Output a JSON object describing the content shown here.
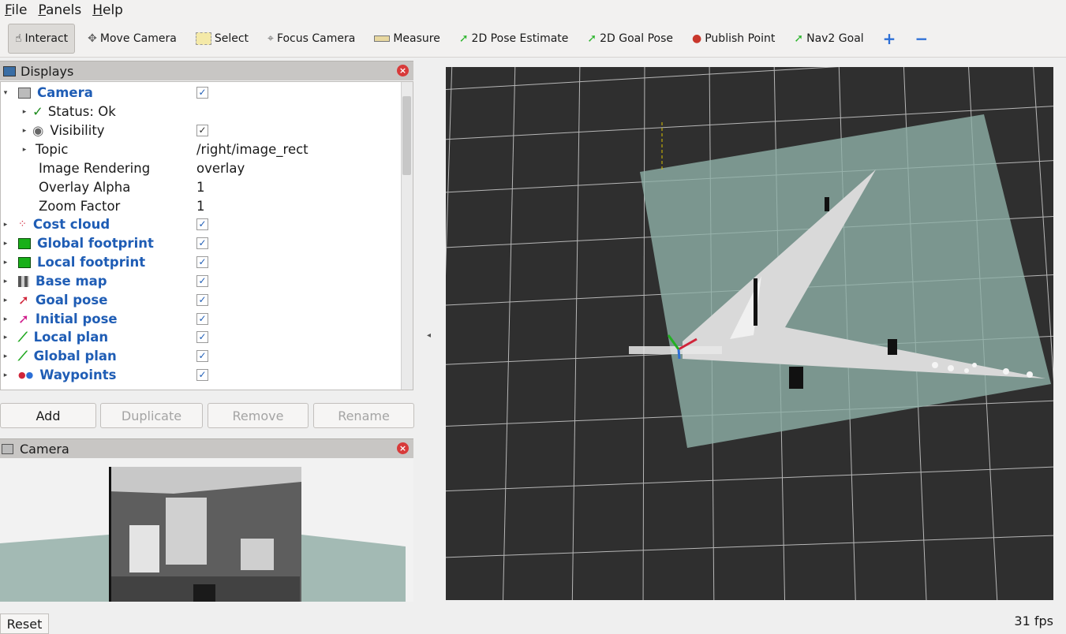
{
  "menu": [
    "File",
    "Panels",
    "Help"
  ],
  "toolbar": [
    {
      "label": "Interact",
      "icon": "hand-pointer-icon",
      "glyph": "☝"
    },
    {
      "label": "Move Camera",
      "icon": "move-camera-icon",
      "glyph": "✥"
    },
    {
      "label": "Select",
      "icon": "select-icon",
      "glyph": "▭"
    },
    {
      "label": "Focus Camera",
      "icon": "focus-camera-icon",
      "glyph": "⌖"
    },
    {
      "label": "Measure",
      "icon": "ruler-icon",
      "glyph": "▬"
    },
    {
      "label": "2D Pose Estimate",
      "icon": "green-arrow-icon",
      "glyph": "➚"
    },
    {
      "label": "2D Goal Pose",
      "icon": "green-arrow-icon",
      "glyph": "➚"
    },
    {
      "label": "Publish Point",
      "icon": "map-pin-icon",
      "glyph": "📍"
    },
    {
      "label": "Nav2 Goal",
      "icon": "green-arrow-icon",
      "glyph": "➚"
    }
  ],
  "displays": {
    "title": "Displays",
    "rows": [
      {
        "label": "Camera",
        "value": "✓",
        "kind": "display",
        "icon": "camera-icon"
      },
      {
        "label": "Status: Ok",
        "value": "",
        "kind": "status"
      },
      {
        "label": "Visibility",
        "value": "✓",
        "kind": "child-arrow"
      },
      {
        "label": "Topic",
        "value": "/right/image_rect",
        "kind": "child-arrow"
      },
      {
        "label": "Image Rendering",
        "value": "overlay",
        "kind": "child"
      },
      {
        "label": "Overlay Alpha",
        "value": "1",
        "kind": "child"
      },
      {
        "label": "Zoom Factor",
        "value": "1",
        "kind": "child"
      },
      {
        "label": "Cost cloud",
        "value": "✓",
        "kind": "display"
      },
      {
        "label": "Global footprint",
        "value": "✓",
        "kind": "display"
      },
      {
        "label": "Local footprint",
        "value": "✓",
        "kind": "display"
      },
      {
        "label": "Base map",
        "value": "✓",
        "kind": "display"
      },
      {
        "label": "Goal pose",
        "value": "✓",
        "kind": "display"
      },
      {
        "label": "Initial pose",
        "value": "✓",
        "kind": "display"
      },
      {
        "label": "Local plan",
        "value": "✓",
        "kind": "display"
      },
      {
        "label": "Global plan",
        "value": "✓",
        "kind": "display"
      },
      {
        "label": "Waypoints",
        "value": "✓",
        "kind": "display"
      }
    ]
  },
  "buttons": {
    "add": "Add",
    "duplicate": "Duplicate",
    "remove": "Remove",
    "rename": "Rename"
  },
  "camera_panel": {
    "title": "Camera"
  },
  "status": {
    "reset": "Reset",
    "fps": "31 fps"
  },
  "colors": {
    "accent_blue": "#1f5db5",
    "viewport_bg": "#2f2f2f",
    "map_overlay": "#8fb0a8"
  }
}
